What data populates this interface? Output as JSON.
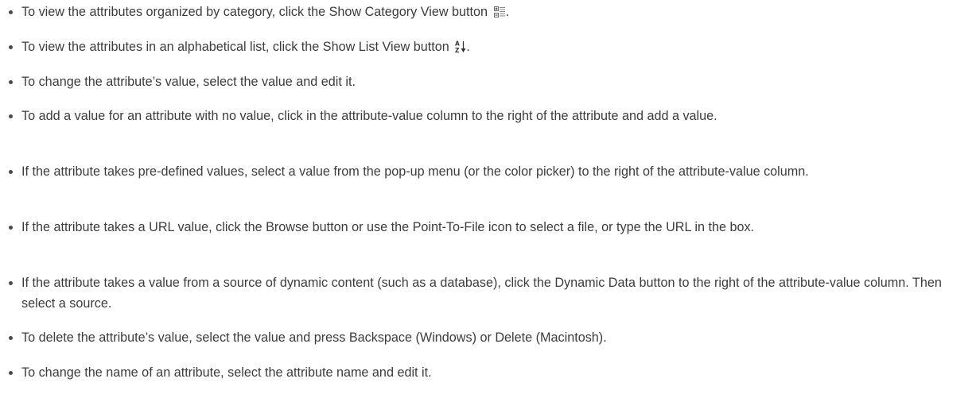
{
  "items": [
    {
      "text": "To view the attributes organized by category, click the Show Category View button",
      "icon": "category-view-icon",
      "suffix": "."
    },
    {
      "text": "To view the attributes in an alphabetical list, click the Show List View button",
      "icon": "sort-az-icon",
      "suffix": "."
    },
    {
      "text": "To change the attribute’s value, select the value and edit it."
    },
    {
      "text": "To add a value for an attribute with no value, click in the attribute-value column to the right of the attribute and add a value."
    },
    {
      "text": "If the attribute takes pre-defined values, select a value from the pop-up menu (or the color picker) to the right of the attribute-value column."
    },
    {
      "text": "If the attribute takes a URL value, click the Browse button or use the Point-To-File icon to select a file, or type the URL in the box."
    },
    {
      "text": "If the attribute takes a value from a source of dynamic content (such as a database), click the Dynamic Data button to the right of the attribute-value column. Then select a source."
    },
    {
      "text": "To delete the attribute’s value, select the value and press Backspace (Windows) or Delete (Macintosh)."
    },
    {
      "text": "To change the name of an attribute, select the attribute name and edit it."
    }
  ],
  "colors": {
    "text": "#3c3c3c",
    "bullet": "#4a4a4a",
    "background": "#ffffff"
  }
}
